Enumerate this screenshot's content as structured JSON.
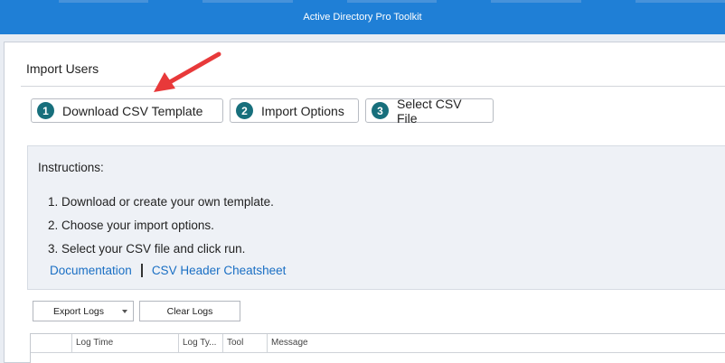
{
  "window": {
    "title": "Active Directory Pro Toolkit"
  },
  "panel": {
    "title": "Import Users"
  },
  "steps": [
    {
      "num": "1",
      "label": "Download CSV Template"
    },
    {
      "num": "2",
      "label": "Import Options"
    },
    {
      "num": "3",
      "label": "Select CSV File"
    }
  ],
  "instructions": {
    "title": "Instructions:",
    "items": [
      "1. Download or create your own template.",
      "2. Choose your import options.",
      "3. Select your CSV file and click run."
    ],
    "links": {
      "documentation": "Documentation",
      "cheatsheet": "CSV Header Cheatsheet"
    }
  },
  "log_toolbar": {
    "export_label": "Export Logs",
    "clear_label": "Clear Logs"
  },
  "log_table": {
    "columns": [
      "",
      "Log Time",
      "Log Ty...",
      "Tool",
      "Message"
    ]
  },
  "colors": {
    "titlebar": "#1f7fd6",
    "step_badge": "#176f7c",
    "link": "#1a6fc4",
    "annotation_arrow": "#e8393a"
  }
}
